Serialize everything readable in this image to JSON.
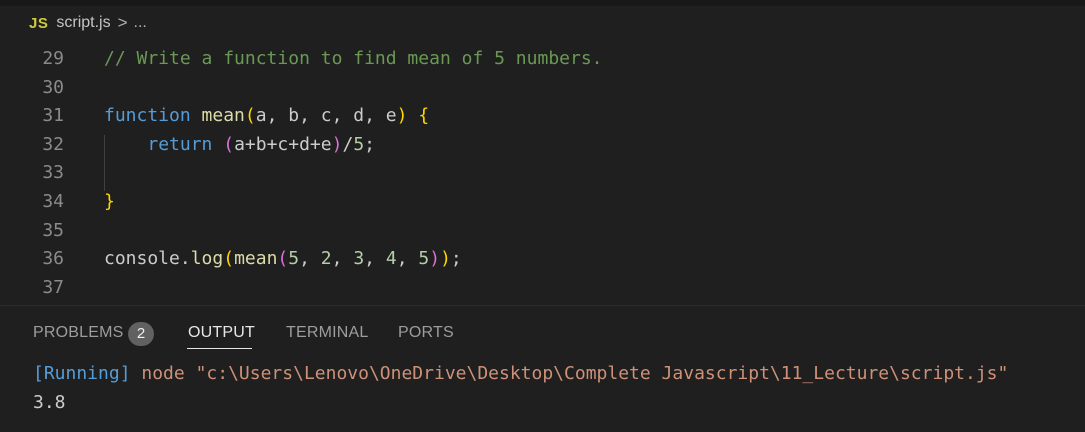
{
  "breadcrumb": {
    "file_icon_text": "JS",
    "file_name": "script.js",
    "separator": ">",
    "more": "..."
  },
  "editor": {
    "lines": [
      {
        "number": "29",
        "parts": [
          {
            "t": "// Write a function to find mean of 5 numbers.",
            "k": "comment"
          }
        ]
      },
      {
        "number": "30",
        "parts": []
      },
      {
        "number": "31",
        "parts": [
          {
            "t": "function",
            "k": "kw"
          },
          {
            "t": " ",
            "k": "id"
          },
          {
            "t": "mean",
            "k": "fn"
          },
          {
            "t": "(",
            "k": "p1"
          },
          {
            "t": "a, b, c, d, e",
            "k": "id"
          },
          {
            "t": ")",
            "k": "p1"
          },
          {
            "t": " ",
            "k": "id"
          },
          {
            "t": "{",
            "k": "p1"
          }
        ]
      },
      {
        "number": "32",
        "parts": [
          {
            "t": "    ",
            "k": "id"
          },
          {
            "t": "return",
            "k": "kw2"
          },
          {
            "t": " ",
            "k": "id"
          },
          {
            "t": "(",
            "k": "p2"
          },
          {
            "t": "a+b+c+d+e",
            "k": "id"
          },
          {
            "t": ")",
            "k": "p2"
          },
          {
            "t": "/",
            "k": "id"
          },
          {
            "t": "5",
            "k": "num"
          },
          {
            "t": ";",
            "k": "id"
          }
        ]
      },
      {
        "number": "33",
        "parts": []
      },
      {
        "number": "34",
        "parts": [
          {
            "t": "}",
            "k": "p1"
          }
        ]
      },
      {
        "number": "35",
        "parts": []
      },
      {
        "number": "36",
        "parts": [
          {
            "t": "console",
            "k": "id"
          },
          {
            "t": ".",
            "k": "id"
          },
          {
            "t": "log",
            "k": "fn"
          },
          {
            "t": "(",
            "k": "p1"
          },
          {
            "t": "mean",
            "k": "fn"
          },
          {
            "t": "(",
            "k": "p2"
          },
          {
            "t": "5",
            "k": "num"
          },
          {
            "t": ", ",
            "k": "id"
          },
          {
            "t": "2",
            "k": "num"
          },
          {
            "t": ", ",
            "k": "id"
          },
          {
            "t": "3",
            "k": "num"
          },
          {
            "t": ", ",
            "k": "id"
          },
          {
            "t": "4",
            "k": "num"
          },
          {
            "t": ", ",
            "k": "id"
          },
          {
            "t": "5",
            "k": "num"
          },
          {
            "t": ")",
            "k": "p2"
          },
          {
            "t": ")",
            "k": "p1"
          },
          {
            "t": ";",
            "k": "id"
          }
        ]
      },
      {
        "number": "37",
        "parts": []
      }
    ]
  },
  "panel": {
    "tabs": [
      {
        "label": "PROBLEMS",
        "active": false
      },
      {
        "label": "OUTPUT",
        "active": true
      },
      {
        "label": "TERMINAL",
        "active": false
      },
      {
        "label": "PORTS",
        "active": false
      }
    ],
    "problems_count": "2",
    "output": {
      "running_tag": "[Running]",
      "command": " node \"c:\\Users\\Lenovo\\OneDrive\\Desktop\\Complete Javascript\\11_Lecture\\script.js\"",
      "result": "3.8"
    }
  },
  "colors": {
    "background": "#1f1f1f",
    "js_icon": "#cbcb41",
    "comment": "#6a9955",
    "keyword": "#569cd6",
    "function": "#dcdcaa",
    "number": "#b5cea8",
    "bracket1": "#ffd700",
    "bracket2": "#da70d6",
    "string": "#ce9178"
  }
}
